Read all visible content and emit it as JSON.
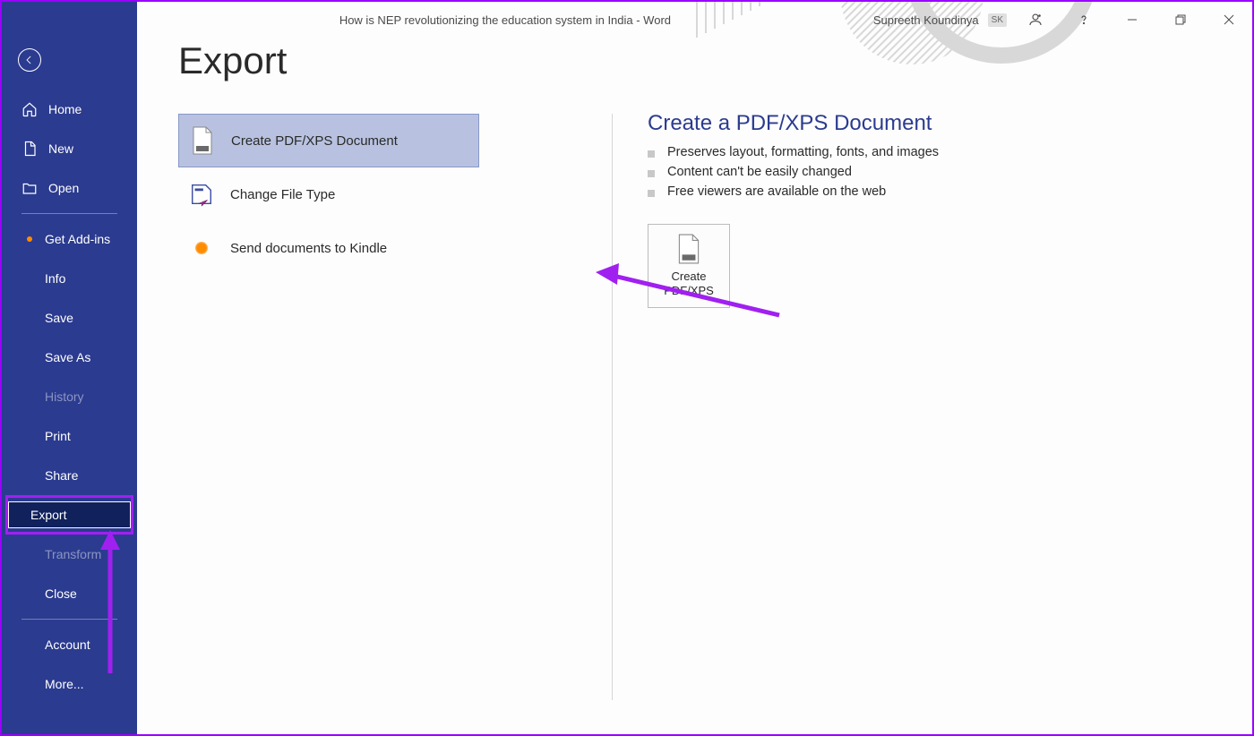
{
  "titlebar": {
    "document_title": "How is NEP revolutionizing the education system in India  -  Word",
    "username": "Supreeth Koundinya",
    "user_initials": "SK"
  },
  "sidebar": {
    "home": "Home",
    "new": "New",
    "open": "Open",
    "get_addins": "Get Add-ins",
    "info": "Info",
    "save": "Save",
    "save_as": "Save As",
    "history": "History",
    "print": "Print",
    "share": "Share",
    "export": "Export",
    "transform": "Transform",
    "close": "Close",
    "account": "Account",
    "more": "More..."
  },
  "page": {
    "title": "Export"
  },
  "export_options": {
    "create_pdf": "Create PDF/XPS Document",
    "change_file_type": "Change File Type",
    "send_kindle": "Send documents to Kindle"
  },
  "detail": {
    "heading": "Create a PDF/XPS Document",
    "bullets": [
      "Preserves layout, formatting, fonts, and images",
      "Content can't be easily changed",
      "Free viewers are available on the web"
    ],
    "button_line1": "Create",
    "button_line2": "PDF/XPS"
  }
}
